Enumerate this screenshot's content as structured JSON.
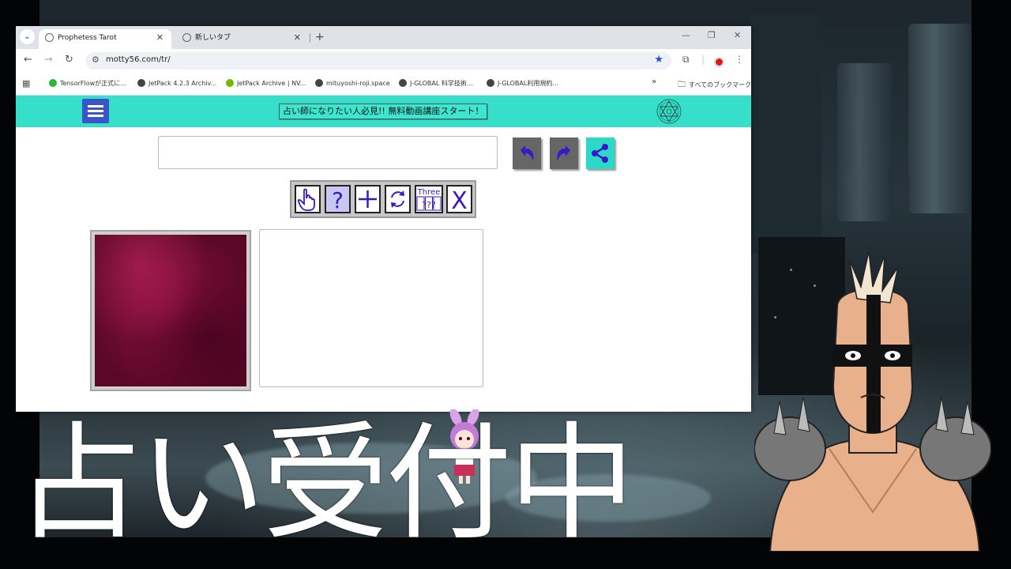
{
  "browser": {
    "tabs": [
      {
        "title": "Prophetess Tarot",
        "active": true
      },
      {
        "title": "新しいタブ",
        "active": false
      }
    ],
    "new_tab_label": "+",
    "url": "motty56.com/tr/",
    "bookmarks": [
      {
        "label": "TensorFlowが正式に...",
        "icon_color": "#2db53c"
      },
      {
        "label": "JetPack 4.2.3 Archiv...",
        "icon_color": "#444444"
      },
      {
        "label": "JetPack Archive | NV...",
        "icon_color": "#76b900"
      },
      {
        "label": "mituyoshi-roji.space",
        "icon_color": "#444444"
      },
      {
        "label": "J-GLOBAL 科学技術...",
        "icon_color": "#444444"
      },
      {
        "label": "J-GLOBAL利用規約...",
        "icon_color": "#444444"
      }
    ],
    "bookmarks_overflow": "»",
    "all_bookmarks_label": "すべてのブックマーク"
  },
  "site": {
    "promo_text": "占い師になりたい人必見!! 無料動画講座スタート！",
    "question_value": "",
    "reading_text": "",
    "tools": [
      {
        "name": "pick",
        "label": ""
      },
      {
        "name": "help",
        "label": "?"
      },
      {
        "name": "add",
        "label": "+"
      },
      {
        "name": "reset",
        "label": ""
      },
      {
        "name": "three",
        "label": "Three",
        "sub": "???"
      },
      {
        "name": "close",
        "label": "X"
      }
    ],
    "colors": {
      "header": "#35dfc9",
      "menu": "#3a55c8",
      "icon": "#3a17c9",
      "card": "#8e1142"
    }
  },
  "overlay": {
    "subtitle": "占い受付中"
  }
}
